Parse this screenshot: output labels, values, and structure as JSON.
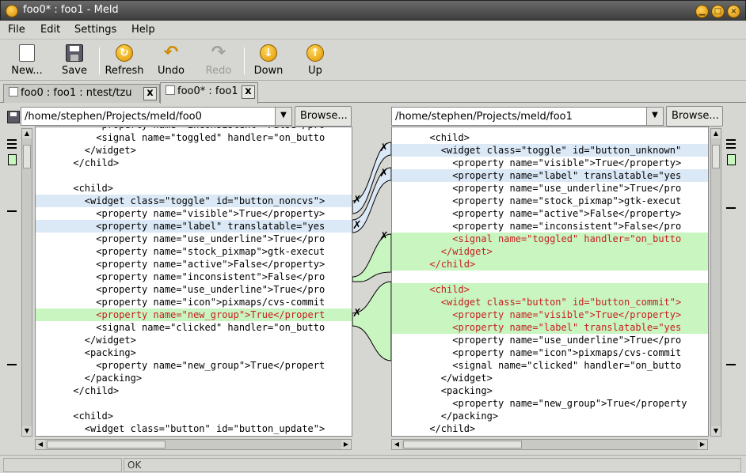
{
  "window": {
    "title": "foo0* : foo1 - Meld"
  },
  "menus": [
    "File",
    "Edit",
    "Settings",
    "Help"
  ],
  "toolbar": {
    "new": "New...",
    "save": "Save",
    "refresh": "Refresh",
    "undo": "Undo",
    "redo": "Redo",
    "down": "Down",
    "up": "Up"
  },
  "tabs": [
    {
      "label": "foo0 : foo1 : ntest/tzu",
      "close": "x",
      "active": false
    },
    {
      "label": "foo0* : foo1",
      "close": "x",
      "active": true
    }
  ],
  "left": {
    "path": "/home/stephen/Projects/meld/foo0",
    "browse": "Browse...",
    "lines": [
      {
        "t": "          <property name=\"inconsistent\">False</pro",
        "c": ""
      },
      {
        "t": "          <signal name=\"toggled\" handler=\"on_butto",
        "c": ""
      },
      {
        "t": "        </widget>",
        "c": ""
      },
      {
        "t": "      </child>",
        "c": ""
      },
      {
        "t": "",
        "c": ""
      },
      {
        "t": "      <child>",
        "c": ""
      },
      {
        "t": "        <widget class=\"toggle\" id=\"button_noncvs\">",
        "c": "blue"
      },
      {
        "t": "          <property name=\"visible\">True</property>",
        "c": ""
      },
      {
        "t": "          <property name=\"label\" translatable=\"yes",
        "c": "blue"
      },
      {
        "t": "          <property name=\"use_underline\">True</pro",
        "c": ""
      },
      {
        "t": "          <property name=\"stock_pixmap\">gtk-execut",
        "c": ""
      },
      {
        "t": "          <property name=\"active\">False</property>",
        "c": ""
      },
      {
        "t": "          <property name=\"inconsistent\">False</pro",
        "c": ""
      },
      {
        "t": "          <property name=\"use_underline\">True</pro",
        "c": ""
      },
      {
        "t": "          <property name=\"icon\">pixmaps/cvs-commit",
        "c": ""
      },
      {
        "t": "          <property name=\"new_group\">True</propert",
        "c": "green red"
      },
      {
        "t": "          <signal name=\"clicked\" handler=\"on_butto",
        "c": ""
      },
      {
        "t": "        </widget>",
        "c": ""
      },
      {
        "t": "        <packing>",
        "c": ""
      },
      {
        "t": "          <property name=\"new_group\">True</propert",
        "c": ""
      },
      {
        "t": "        </packing>",
        "c": ""
      },
      {
        "t": "      </child>",
        "c": ""
      },
      {
        "t": "",
        "c": ""
      },
      {
        "t": "      <child>",
        "c": ""
      },
      {
        "t": "        <widget class=\"button\" id=\"button_update\">",
        "c": ""
      }
    ]
  },
  "right": {
    "path": "/home/stephen/Projects/meld/foo1",
    "browse": "Browse...",
    "lines": [
      {
        "t": "      <child>",
        "c": ""
      },
      {
        "t": "        <widget class=\"toggle\" id=\"button_unknown\"",
        "c": "blue"
      },
      {
        "t": "          <property name=\"visible\">True</property>",
        "c": ""
      },
      {
        "t": "          <property name=\"label\" translatable=\"yes",
        "c": "blue"
      },
      {
        "t": "          <property name=\"use_underline\">True</pro",
        "c": ""
      },
      {
        "t": "          <property name=\"stock_pixmap\">gtk-execut",
        "c": ""
      },
      {
        "t": "          <property name=\"active\">False</property>",
        "c": ""
      },
      {
        "t": "          <property name=\"inconsistent\">False</pro",
        "c": ""
      },
      {
        "t": "          <signal name=\"toggled\" handler=\"on_butto",
        "c": "green red"
      },
      {
        "t": "        </widget>",
        "c": "green red"
      },
      {
        "t": "      </child>",
        "c": "green red"
      },
      {
        "t": "",
        "c": ""
      },
      {
        "t": "      <child>",
        "c": "green red"
      },
      {
        "t": "        <widget class=\"button\" id=\"button_commit\">",
        "c": "green red"
      },
      {
        "t": "          <property name=\"visible\">True</property>",
        "c": "green red"
      },
      {
        "t": "          <property name=\"label\" translatable=\"yes",
        "c": "green red"
      },
      {
        "t": "          <property name=\"use_underline\">True</pro",
        "c": ""
      },
      {
        "t": "          <property name=\"icon\">pixmaps/cvs-commit",
        "c": ""
      },
      {
        "t": "          <signal name=\"clicked\" handler=\"on_butto",
        "c": ""
      },
      {
        "t": "        </widget>",
        "c": ""
      },
      {
        "t": "        <packing>",
        "c": ""
      },
      {
        "t": "          <property name=\"new_group\">True</property",
        "c": ""
      },
      {
        "t": "        </packing>",
        "c": ""
      },
      {
        "t": "      </child>",
        "c": ""
      }
    ]
  },
  "status": {
    "text": "OK"
  },
  "colors": {
    "blue_change": "#dbe8f6",
    "green_insert": "#c8f5c0",
    "red_text": "#c81e1e"
  }
}
